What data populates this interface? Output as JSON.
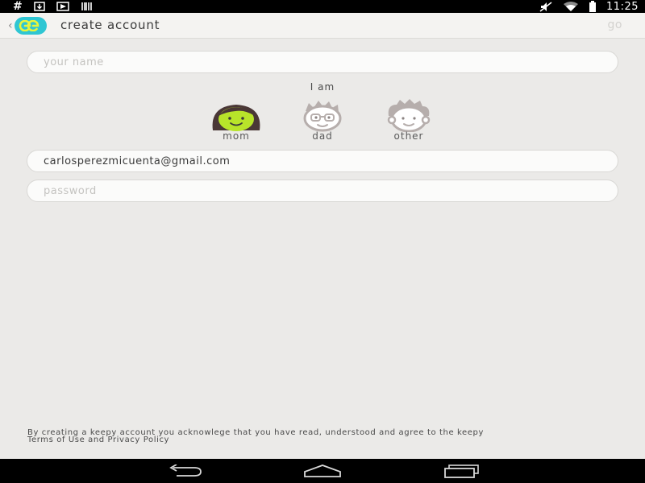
{
  "status_bar": {
    "left_icons": [
      "hash-icon",
      "download-icon",
      "play-store-icon",
      "barcode-icon"
    ],
    "right_icons": [
      "mute-icon",
      "wifi-icon",
      "battery-icon"
    ],
    "time": "11:25",
    "hash_glyph": "#"
  },
  "action_bar": {
    "back_glyph": "‹",
    "logo_icon": "keepy-logo-icon",
    "title": "create account",
    "go_label": "go"
  },
  "form": {
    "name_placeholder": "your name",
    "name_value": "",
    "i_am_label": "I am",
    "roles": [
      {
        "label": "mom",
        "selected": true
      },
      {
        "label": "dad",
        "selected": false
      },
      {
        "label": "other",
        "selected": false
      }
    ],
    "email_value": "carlosperezmicuenta@gmail.com",
    "password_placeholder": "password"
  },
  "legal": {
    "text": "By creating a keepy account you acknowlege that you have read, understood and agree to the keepy",
    "terms_link": "Terms of Use",
    "and_text": "and",
    "privacy_link": "Privacy Policy"
  },
  "colors": {
    "accent": "#2fc6d3",
    "selected_face": "#b8e42a",
    "background": "#ebeae8"
  },
  "nav_bar": {
    "icons": [
      "back-nav-icon",
      "home-nav-icon",
      "recents-nav-icon"
    ]
  }
}
